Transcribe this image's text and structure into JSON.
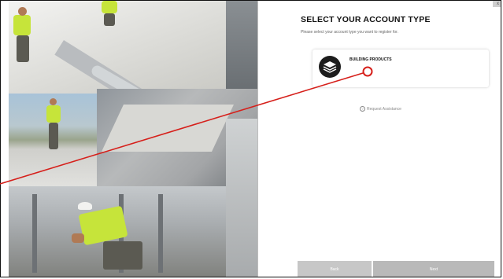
{
  "panel": {
    "title": "SELECT YOUR ACCOUNT TYPE",
    "subtitle": "Please select your account type you want to register for.",
    "close_label": "x"
  },
  "account_types": [
    {
      "label": "BUILDING PRODUCTS",
      "icon": "building-products-icon"
    }
  ],
  "assistance": {
    "icon": "help-circle-icon",
    "label": "Request Assistance"
  },
  "footer": {
    "back_label": "Back",
    "next_label": "Next"
  },
  "colors": {
    "callout": "#d6201b",
    "vest": "#c6e43a",
    "button_back": "#c7c7c7",
    "button_next": "#b9b9b9"
  }
}
